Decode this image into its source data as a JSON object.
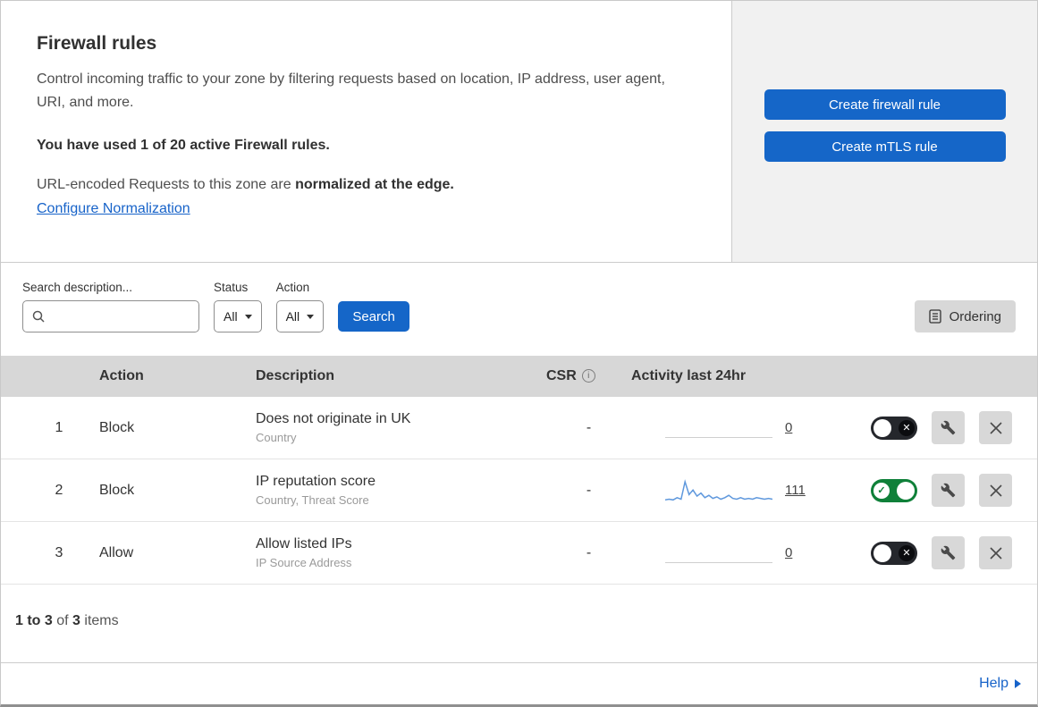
{
  "header": {
    "title": "Firewall rules",
    "description": "Control incoming traffic to your zone by filtering requests based on location, IP address, user agent, URI, and more.",
    "usage": "You have used 1 of 20 active Firewall rules.",
    "normalization_prefix": "URL-encoded Requests to this zone are ",
    "normalization_bold": "normalized at the edge.",
    "normalization_link": "Configure Normalization",
    "buttons": {
      "create_firewall_rule": "Create firewall rule",
      "create_mtls_rule": "Create mTLS rule"
    }
  },
  "filters": {
    "search_label": "Search description...",
    "search_value": "",
    "status_label": "Status",
    "status_value": "All",
    "action_label": "Action",
    "action_value": "All",
    "search_button": "Search",
    "ordering_button": "Ordering"
  },
  "table": {
    "columns": {
      "action": "Action",
      "description": "Description",
      "csr": "CSR",
      "activity": "Activity last 24hr"
    },
    "rows": [
      {
        "index": "1",
        "action": "Block",
        "description": "Does not originate in UK",
        "fields": "Country",
        "csr": "-",
        "activity_count": "0",
        "enabled": false,
        "has_sparkline": false
      },
      {
        "index": "2",
        "action": "Block",
        "description": "IP reputation score",
        "fields": "Country, Threat Score",
        "csr": "-",
        "activity_count": "111",
        "enabled": true,
        "has_sparkline": true
      },
      {
        "index": "3",
        "action": "Allow",
        "description": "Allow listed IPs",
        "fields": "IP Source Address",
        "csr": "-",
        "activity_count": "0",
        "enabled": false,
        "has_sparkline": false
      }
    ]
  },
  "sparkline": {
    "values": [
      2,
      3,
      2,
      5,
      3,
      26,
      9,
      15,
      7,
      11,
      5,
      8,
      4,
      6,
      3,
      5,
      8,
      4,
      3,
      5,
      3,
      4,
      3,
      5,
      4,
      3,
      4,
      3
    ]
  },
  "footer": {
    "range": "1 to 3",
    "of": "of",
    "total": "3",
    "items": "items",
    "help": "Help"
  },
  "icons": {
    "info": "i",
    "toggle_on": "✓",
    "toggle_off": "✕"
  },
  "colors": {
    "primary_blue": "#1566c8",
    "link_blue": "#1763c9",
    "toggle_green": "#0f8039",
    "toggle_off_dark": "#25272c",
    "sparkline_blue": "#5f98dd",
    "panel_gray": "#f1f1f1",
    "table_header_gray": "#d7d7d7"
  }
}
